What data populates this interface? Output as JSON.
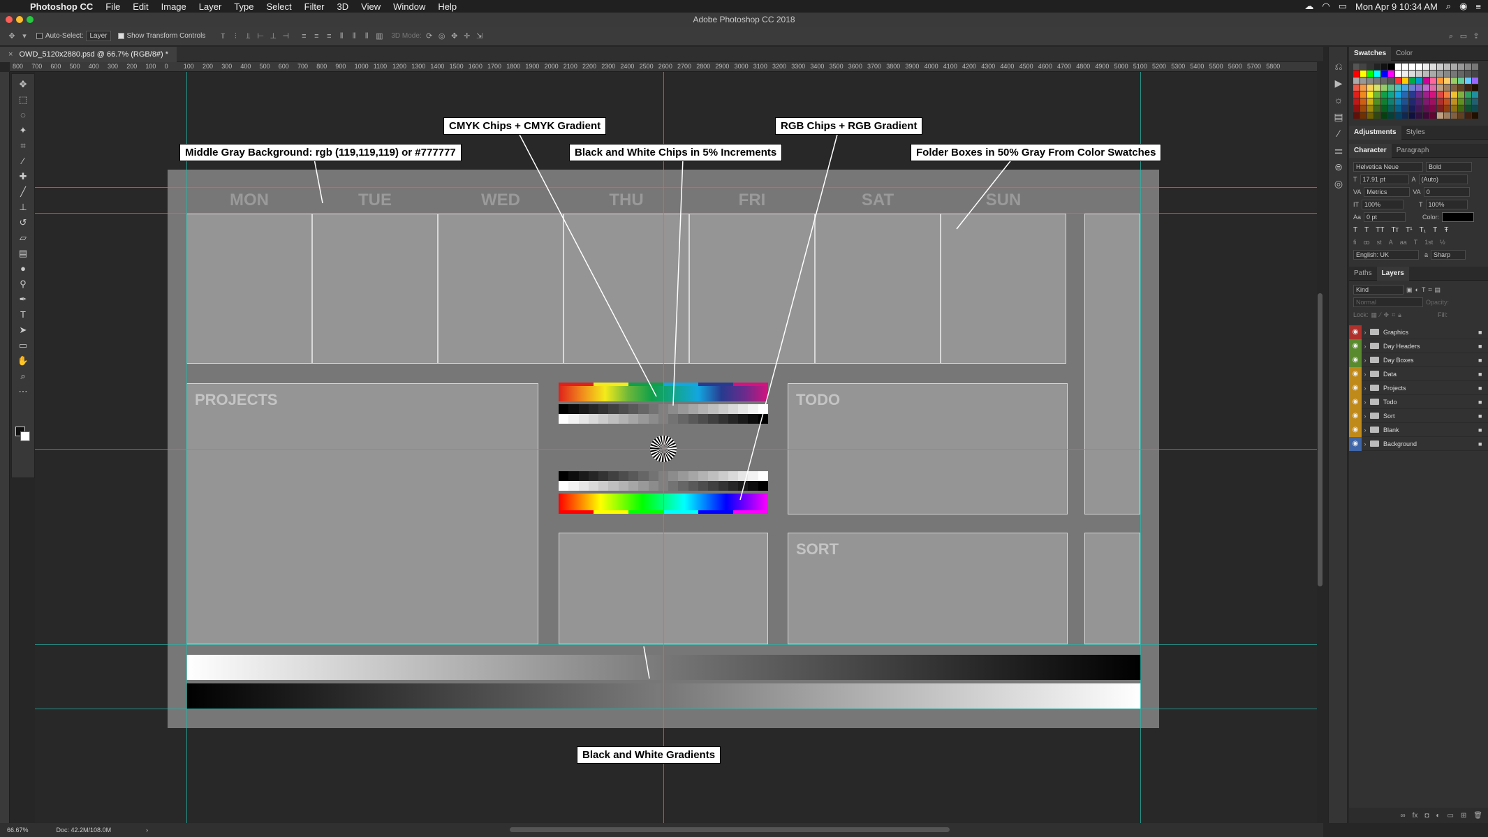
{
  "menubar": {
    "app": "Photoshop CC",
    "items": [
      "File",
      "Edit",
      "Image",
      "Layer",
      "Type",
      "Select",
      "Filter",
      "3D",
      "View",
      "Window",
      "Help"
    ],
    "clock": "Mon Apr 9  10:34 AM"
  },
  "window": {
    "title": "Adobe Photoshop CC 2018"
  },
  "options": {
    "auto_select_label": "Auto-Select:",
    "auto_select_value": "Layer",
    "transform_label": "Show Transform Controls",
    "mode_3d_label": "3D Mode:"
  },
  "document": {
    "tab_title": "OWD_5120x2880.psd @ 66.7% (RGB/8#) *"
  },
  "ruler_ticks": [
    "800",
    "700",
    "600",
    "500",
    "400",
    "300",
    "200",
    "100",
    "0",
    "100",
    "200",
    "300",
    "400",
    "500",
    "600",
    "700",
    "800",
    "900",
    "1000",
    "1100",
    "1200",
    "1300",
    "1400",
    "1500",
    "1600",
    "1700",
    "1800",
    "1900",
    "2000",
    "2100",
    "2200",
    "2300",
    "2400",
    "2500",
    "2600",
    "2700",
    "2800",
    "2900",
    "3000",
    "3100",
    "3200",
    "3300",
    "3400",
    "3500",
    "3600",
    "3700",
    "3800",
    "3900",
    "4000",
    "4100",
    "4200",
    "4300",
    "4400",
    "4500",
    "4600",
    "4700",
    "4800",
    "4900",
    "5000",
    "5100",
    "5200",
    "5300",
    "5400",
    "5500",
    "5600",
    "5700",
    "5800"
  ],
  "canvas": {
    "days": [
      "MON",
      "TUE",
      "WED",
      "THU",
      "FRI",
      "SAT",
      "SUN"
    ],
    "folders": {
      "projects": "PROJECTS",
      "todo": "TODO",
      "sort": "SORT"
    },
    "background_color": "#777777",
    "guide_color": "#25b5a8"
  },
  "callouts": {
    "middle_gray": "Middle Gray Background: rgb (119,119,119) or #777777",
    "cmyk": "CMYK Chips + CMYK Gradient",
    "bw_chips": "Black and White Chips in 5% Increments",
    "rgb": "RGB Chips + RGB Gradient",
    "folder_boxes": "Folder Boxes in 50% Gray From Color Swatches",
    "bw_gradients": "Black and White Gradients"
  },
  "panels": {
    "swatches_tabs": [
      "Swatches",
      "Color"
    ],
    "adjust_tabs": [
      "Adjustments",
      "Styles"
    ],
    "char_tabs": [
      "Character",
      "Paragraph"
    ],
    "font_family": "Helvetica Neue",
    "font_style": "Bold",
    "font_size": "17.91 pt",
    "leading": "(Auto)",
    "kerning": "Metrics",
    "tracking": "0",
    "v_scale": "100%",
    "h_scale": "100%",
    "baseline": "0 pt",
    "color_label": "Color:",
    "language": "English: UK",
    "aa": "Sharp",
    "layers_tabs": [
      "Paths",
      "Layers"
    ],
    "kind_label": "Kind",
    "blend_mode": "Normal",
    "opacity_label": "Opacity:",
    "lock_label": "Lock:",
    "fill_label": "Fill:",
    "layers": [
      {
        "name": "Graphics",
        "eye_color": "#b0302c"
      },
      {
        "name": "Day Headers",
        "eye_color": "#5a8a2e"
      },
      {
        "name": "Day Boxes",
        "eye_color": "#5a8a2e"
      },
      {
        "name": "Data",
        "eye_color": "#c08a1a"
      },
      {
        "name": "Projects",
        "eye_color": "#c08a1a"
      },
      {
        "name": "Todo",
        "eye_color": "#c08a1a"
      },
      {
        "name": "Sort",
        "eye_color": "#c08a1a"
      },
      {
        "name": "Blank",
        "eye_color": "#c08a1a"
      },
      {
        "name": "Background",
        "eye_color": "#3f66a8"
      }
    ]
  },
  "status": {
    "zoom": "66.67%",
    "doc": "Doc: 42.2M/108.0M"
  }
}
